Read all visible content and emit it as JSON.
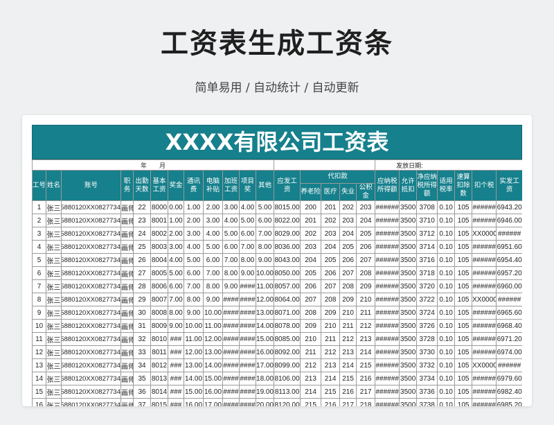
{
  "title": "工资表生成工资条",
  "subtitle": "简单易用 / 自动统计 / 自动更新",
  "sheet": {
    "banner": "XXXX有限公司工资表",
    "year_month": "年　　月",
    "issue_date_label": "发放日期:",
    "headers": {
      "no": "工号",
      "name": "姓名",
      "account": "账号",
      "position": "职务",
      "attendance": "出勤天数",
      "base": "基本工资",
      "bonus": "奖金",
      "comm": "通讯费",
      "pc": "电脑补贴",
      "ot": "加班工资",
      "proj": "项目奖",
      "other": "其他",
      "gross": "应发工资",
      "withheld": "代扣款",
      "pension": "养老险",
      "medical": "医疗",
      "unemp": "失业",
      "fund": "公积金",
      "taxable": "应纳税所得额",
      "allow": "允许抵扣",
      "netTaxable": "净应纳税所得额",
      "rate": "适用税率",
      "quick": "速算扣除数",
      "tax": "扣个税",
      "net": "实发工资"
    },
    "rows": [
      [
        "1",
        "张三",
        "955880120XX0827734",
        "画师",
        "22",
        "8000",
        "0.00",
        "1.00",
        "2.00",
        "3.00",
        "4.00",
        "5.00",
        "8015.00",
        "200",
        "201",
        "202",
        "203",
        "######",
        "3500",
        "3708",
        "0.10",
        "105",
        "######",
        "6943.20"
      ],
      [
        "2",
        "张三",
        "955880120XX0827734",
        "画师",
        "23",
        "8001",
        "1.00",
        "2.00",
        "3.00",
        "4.00",
        "5.00",
        "6.00",
        "8022.00",
        "201",
        "202",
        "203",
        "204",
        "######",
        "3500",
        "3710",
        "0.10",
        "105",
        "######",
        "6946.00"
      ],
      [
        "3",
        "张三",
        "955880120XX0827734",
        "画师",
        "24",
        "8002",
        "2.00",
        "3.00",
        "4.00",
        "5.00",
        "6.00",
        "7.00",
        "8029.00",
        "202",
        "203",
        "204",
        "205",
        "######",
        "3500",
        "3712",
        "0.10",
        "105",
        "XX00000",
        "######"
      ],
      [
        "4",
        "张三",
        "955880120XX0827734",
        "画师",
        "25",
        "8003",
        "3.00",
        "4.00",
        "5.00",
        "6.00",
        "7.00",
        "8.00",
        "8036.00",
        "203",
        "204",
        "205",
        "206",
        "######",
        "3500",
        "3714",
        "0.10",
        "105",
        "######",
        "6951.60"
      ],
      [
        "5",
        "张三",
        "955880120XX0827734",
        "画师",
        "26",
        "8004",
        "4.00",
        "5.00",
        "6.00",
        "7.00",
        "8.00",
        "9.00",
        "8043.00",
        "204",
        "205",
        "206",
        "207",
        "######",
        "3500",
        "3716",
        "0.10",
        "105",
        "######",
        "6954.40"
      ],
      [
        "6",
        "张三",
        "955880120XX0827734",
        "画师",
        "27",
        "8005",
        "5.00",
        "6.00",
        "7.00",
        "8.00",
        "9.00",
        "10.00",
        "8050.00",
        "205",
        "206",
        "207",
        "208",
        "######",
        "3500",
        "3718",
        "0.10",
        "105",
        "######",
        "6957.20"
      ],
      [
        "7",
        "张三",
        "955880120XX0827734",
        "画师",
        "28",
        "8006",
        "6.00",
        "7.00",
        "8.00",
        "9.00",
        "####",
        "11.00",
        "8057.00",
        "206",
        "207",
        "208",
        "209",
        "######",
        "3500",
        "3720",
        "0.10",
        "105",
        "######",
        "6960.00"
      ],
      [
        "8",
        "张三",
        "955880120XX0827734",
        "画师",
        "29",
        "8007",
        "7.00",
        "8.00",
        "9.00",
        "####",
        "####",
        "12.00",
        "8064.00",
        "207",
        "208",
        "209",
        "210",
        "######",
        "3500",
        "3722",
        "0.10",
        "105",
        "XX00000",
        "######"
      ],
      [
        "9",
        "张三",
        "955880120XX0827734",
        "画师",
        "30",
        "8008",
        "8.00",
        "9.00",
        "10.00",
        "####",
        "####",
        "13.00",
        "8071.00",
        "208",
        "209",
        "210",
        "211",
        "######",
        "3500",
        "3724",
        "0.10",
        "105",
        "######",
        "6965.60"
      ],
      [
        "10",
        "张三",
        "955880120XX0827734",
        "画师",
        "31",
        "8009",
        "9.00",
        "10.00",
        "11.00",
        "####",
        "####",
        "14.00",
        "8078.00",
        "209",
        "210",
        "211",
        "212",
        "######",
        "3500",
        "3726",
        "0.10",
        "105",
        "######",
        "6968.40"
      ],
      [
        "11",
        "张三",
        "955880120XX0827734",
        "画师",
        "32",
        "8010",
        "###",
        "11.00",
        "12.00",
        "####",
        "####",
        "15.00",
        "8085.00",
        "210",
        "211",
        "212",
        "213",
        "######",
        "3500",
        "3728",
        "0.10",
        "105",
        "######",
        "6971.20"
      ],
      [
        "12",
        "张三",
        "955880120XX0827734",
        "画师",
        "33",
        "8011",
        "###",
        "12.00",
        "13.00",
        "####",
        "####",
        "16.00",
        "8092.00",
        "211",
        "212",
        "213",
        "214",
        "######",
        "3500",
        "3730",
        "0.10",
        "105",
        "######",
        "6974.00"
      ],
      [
        "13",
        "张三",
        "955880120XX0827734",
        "画师",
        "34",
        "8012",
        "###",
        "13.00",
        "14.00",
        "####",
        "####",
        "17.00",
        "8099.00",
        "212",
        "213",
        "214",
        "215",
        "######",
        "3500",
        "3732",
        "0.10",
        "105",
        "XX00000",
        "######"
      ],
      [
        "14",
        "张三",
        "955880120XX0827734",
        "画师",
        "35",
        "8013",
        "###",
        "14.00",
        "15.00",
        "####",
        "####",
        "18.00",
        "8106.00",
        "213",
        "214",
        "215",
        "216",
        "######",
        "3500",
        "3734",
        "0.10",
        "105",
        "######",
        "6979.60"
      ],
      [
        "15",
        "张三",
        "955880120XX0827734",
        "画师",
        "36",
        "8014",
        "###",
        "15.00",
        "16.00",
        "####",
        "####",
        "19.00",
        "8113.00",
        "214",
        "215",
        "216",
        "217",
        "######",
        "3500",
        "3736",
        "0.10",
        "105",
        "######",
        "6982.40"
      ],
      [
        "16",
        "张三",
        "955880120XX0827734",
        "画师",
        "37",
        "8015",
        "###",
        "16.00",
        "17.00",
        "####",
        "####",
        "20.00",
        "8120.00",
        "215",
        "216",
        "217",
        "218",
        "######",
        "3500",
        "3738",
        "0.10",
        "105",
        "######",
        "6985.20"
      ]
    ]
  }
}
